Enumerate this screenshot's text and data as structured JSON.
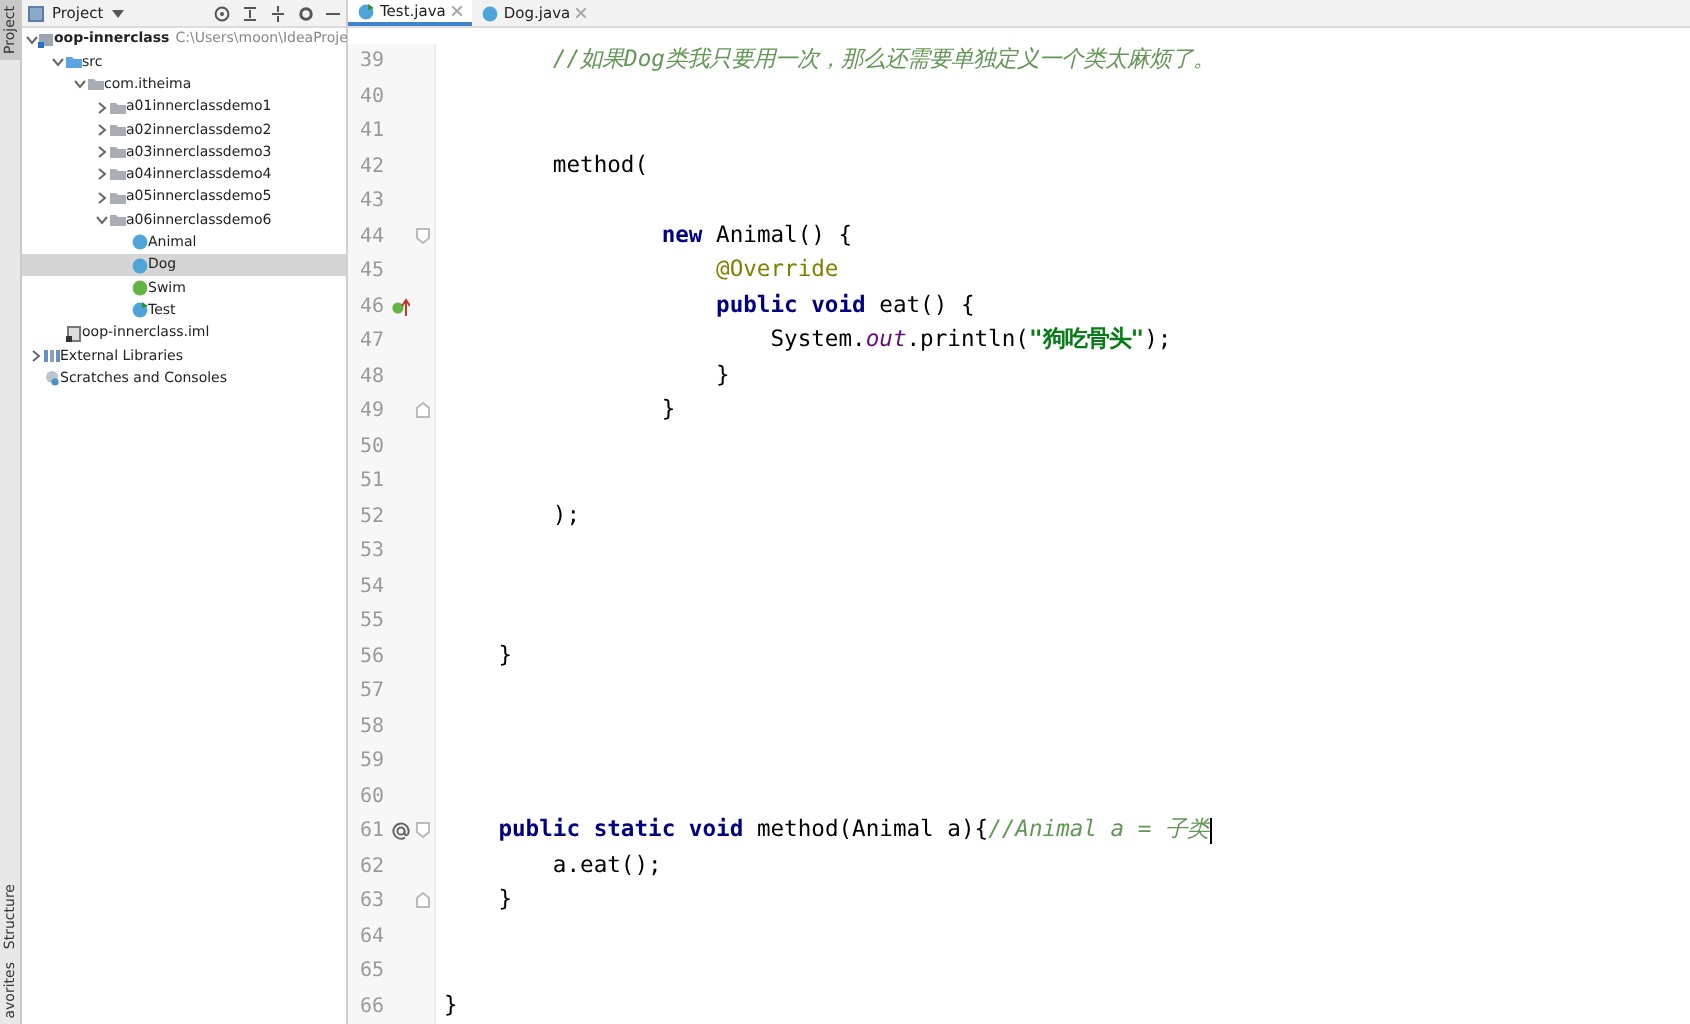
{
  "tool_strip": {
    "top": [
      {
        "label": "Project",
        "selected": true
      }
    ],
    "bottom": [
      {
        "label": "Structure",
        "selected": false
      },
      {
        "label": "avorites",
        "selected": false
      }
    ]
  },
  "project_panel": {
    "title": "Project",
    "tree": [
      {
        "label": "oop-innerclass",
        "hint": "C:\\Users\\moon\\IdeaProje",
        "kind": "module",
        "expanded": true,
        "selected": false,
        "children": [
          {
            "label": "src",
            "kind": "source",
            "expanded": true,
            "selected": false,
            "children": [
              {
                "label": "com.itheima",
                "kind": "package",
                "expanded": true,
                "selected": false,
                "children": [
                  {
                    "label": "a01innerclassdemo1",
                    "kind": "package",
                    "expanded": false,
                    "selected": false
                  },
                  {
                    "label": "a02innerclassdemo2",
                    "kind": "package",
                    "expanded": false,
                    "selected": false
                  },
                  {
                    "label": "a03innerclassdemo3",
                    "kind": "package",
                    "expanded": false,
                    "selected": false
                  },
                  {
                    "label": "a04innerclassdemo4",
                    "kind": "package",
                    "expanded": false,
                    "selected": false
                  },
                  {
                    "label": "a05innerclassdemo5",
                    "kind": "package",
                    "expanded": false,
                    "selected": false
                  },
                  {
                    "label": "a06innerclassdemo6",
                    "kind": "package",
                    "expanded": true,
                    "selected": false,
                    "children": [
                      {
                        "label": "Animal",
                        "kind": "class",
                        "selected": false
                      },
                      {
                        "label": "Dog",
                        "kind": "class",
                        "selected": true
                      },
                      {
                        "label": "Swim",
                        "kind": "interface",
                        "selected": false
                      },
                      {
                        "label": "Test",
                        "kind": "main-class",
                        "selected": false
                      }
                    ]
                  }
                ]
              }
            ]
          },
          {
            "label": "oop-innerclass.iml",
            "kind": "file",
            "selected": false
          }
        ]
      },
      {
        "label": "External Libraries",
        "kind": "library",
        "expanded": false,
        "selected": false
      },
      {
        "label": "Scratches and Consoles",
        "kind": "scratch",
        "selected": false
      }
    ]
  },
  "editor": {
    "tabs": [
      {
        "label": "Test.java",
        "kind": "main-class",
        "selected": true
      },
      {
        "label": "Dog.java",
        "kind": "class",
        "selected": false
      }
    ],
    "lines": [
      {
        "number": "39",
        "tokens": [
          {
            "kind": "comment",
            "text": "        //如果Dog类我只要用一次，那么还需要单独定义一个类太麻烦了。"
          }
        ]
      },
      {
        "number": "40"
      },
      {
        "number": "41"
      },
      {
        "number": "42",
        "tokens": [
          {
            "kind": "plain",
            "text": "        method("
          }
        ]
      },
      {
        "number": "43"
      },
      {
        "number": "44",
        "fold_start": true,
        "tokens": [
          {
            "kind": "keyword",
            "text": "                new"
          },
          {
            "kind": "plain",
            "text": " Animal() {"
          }
        ]
      },
      {
        "number": "45",
        "tokens": [
          {
            "kind": "annotation",
            "text": "                    @Override"
          }
        ]
      },
      {
        "number": "46",
        "implements_mark": true,
        "tokens": [
          {
            "kind": "keyword",
            "text": "                    public void"
          },
          {
            "kind": "plain",
            "text": " eat() {"
          }
        ]
      },
      {
        "number": "47",
        "tokens": [
          {
            "kind": "plain",
            "text": "                        System."
          },
          {
            "kind": "field",
            "text": "out"
          },
          {
            "kind": "plain",
            "text": ".println("
          },
          {
            "kind": "string",
            "text": "\"狗吃骨头\""
          },
          {
            "kind": "plain",
            "text": ");"
          }
        ]
      },
      {
        "number": "48",
        "tokens": [
          {
            "kind": "plain",
            "text": "                    }"
          }
        ]
      },
      {
        "number": "49",
        "fold_end": true,
        "tokens": [
          {
            "kind": "plain",
            "text": "                }"
          }
        ]
      },
      {
        "number": "50"
      },
      {
        "number": "51"
      },
      {
        "number": "52",
        "tokens": [
          {
            "kind": "plain",
            "text": "        );"
          }
        ]
      },
      {
        "number": "53"
      },
      {
        "number": "54"
      },
      {
        "number": "55"
      },
      {
        "number": "56",
        "tokens": [
          {
            "kind": "plain",
            "text": "    }"
          }
        ]
      },
      {
        "number": "57"
      },
      {
        "number": "58"
      },
      {
        "number": "59"
      },
      {
        "number": "60"
      },
      {
        "number": "61",
        "annotation_mark": true,
        "fold_start": true,
        "caret": true,
        "tokens": [
          {
            "kind": "keyword",
            "text": "    public static void"
          },
          {
            "kind": "plain",
            "text": " method(Animal a){"
          },
          {
            "kind": "comment",
            "text": "//Animal a = 子类"
          }
        ]
      },
      {
        "number": "62",
        "tokens": [
          {
            "kind": "plain",
            "text": "        a.eat();"
          }
        ]
      },
      {
        "number": "63",
        "fold_end": true,
        "tokens": [
          {
            "kind": "plain",
            "text": "    }"
          }
        ]
      },
      {
        "number": "64"
      },
      {
        "number": "65"
      },
      {
        "number": "66",
        "tokens": [
          {
            "kind": "plain",
            "text": "}"
          }
        ]
      }
    ]
  }
}
